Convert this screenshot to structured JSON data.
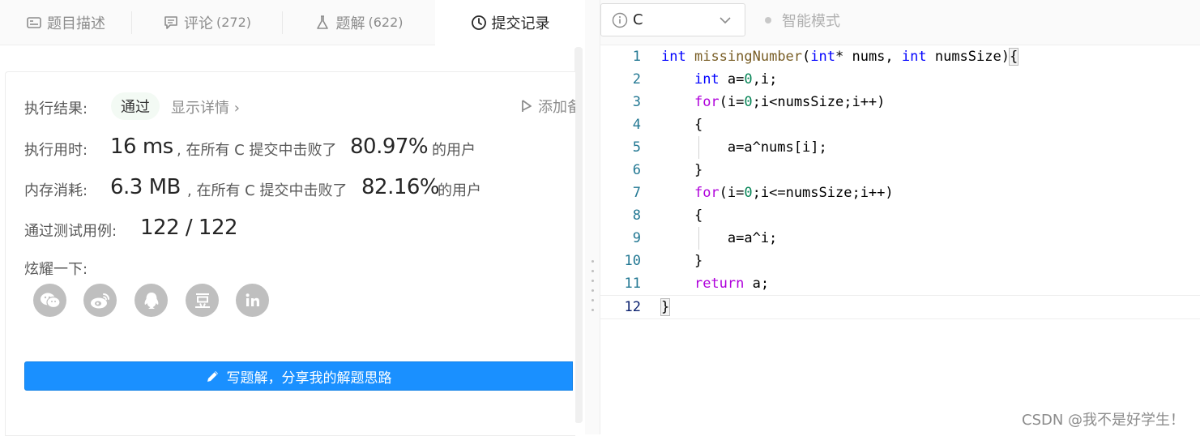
{
  "tabs": [
    {
      "label": "题目描述",
      "count": ""
    },
    {
      "label": "评论",
      "count": "(272)"
    },
    {
      "label": "题解",
      "count": "(622)"
    },
    {
      "label": "提交记录",
      "count": ""
    }
  ],
  "result": {
    "exec_label": "执行结果:",
    "status": "通过",
    "detail_link": "显示详情 ›",
    "add_note": "添加备注",
    "time_label": "执行用时:",
    "time_value": "16 ms",
    "time_note": ", 在所有 C 提交中击败了",
    "time_pct": "80.97%",
    "time_suffix": "的用户",
    "mem_label": "内存消耗:",
    "mem_value": "6.3 MB",
    "mem_note": ", 在所有 C 提交中击败了",
    "mem_pct": "82.16%",
    "mem_suffix": "的用户",
    "cases_label": "通过测试用例:",
    "cases_value": "122 / 122",
    "share_label": "炫耀一下:"
  },
  "share_icons": [
    "wechat-icon",
    "weibo-icon",
    "qq-icon",
    "douban-icon",
    "linkedin-icon"
  ],
  "write_button": "写题解，分享我的解题思路",
  "editor": {
    "language": "C",
    "smart_mode": "智能模式",
    "line_numbers": [
      "1",
      "2",
      "3",
      "4",
      "5",
      "6",
      "7",
      "8",
      "9",
      "10",
      "11",
      "12"
    ]
  },
  "watermark": "CSDN @我不是好学生！",
  "colors": {
    "accent": "#1a90ff",
    "pass_bg": "#f3faf4",
    "line_number": "#237893"
  }
}
